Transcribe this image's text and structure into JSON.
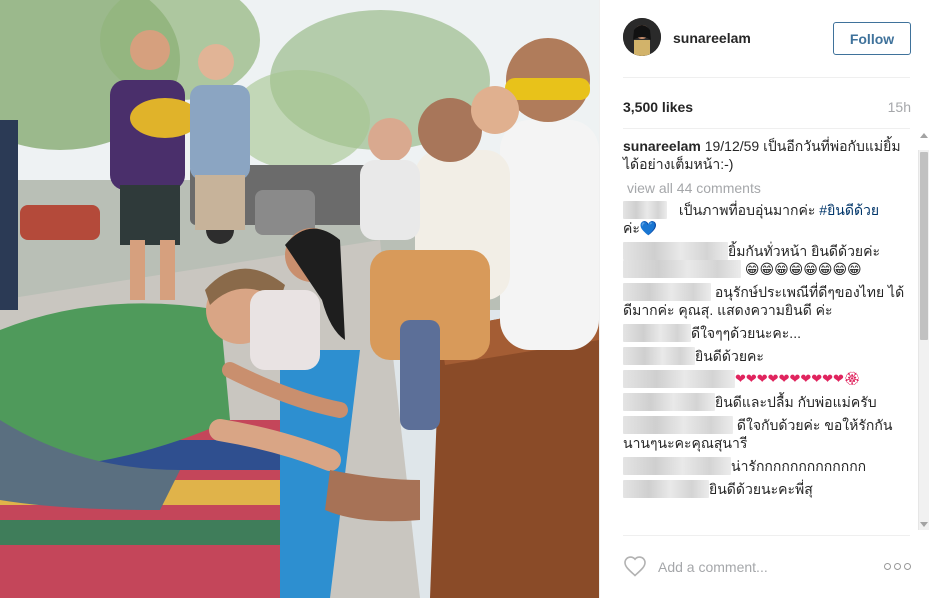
{
  "post": {
    "username": "sunareelam",
    "follow_label": "Follow",
    "likes": "3,500 likes",
    "time": "15h",
    "caption_user": "sunareelam",
    "caption_text": " 19/12/59 เป็นอีกวันที่พ่อกับแม่ยิ้มได้อย่างเต็มหน้า:-)",
    "view_all": "view all 44 comments",
    "add_comment_placeholder": "Add a comment..."
  },
  "comments": [
    {
      "text": "เป็นภาพที่อบอุ่นมากค่ะ ",
      "hashtag": "#ยินดีด้วย",
      "text2": "ค่ะ💙"
    },
    {
      "text": "ยิ้มกันทั่วหน้า ยินดีด้วยค่ะ",
      "emoji": "😁😁😁😁😁😁😁😁"
    },
    {
      "text": "อนุรักษ์ประเพณีที่ดีๆของไทย ได้ดีมากค่ะ คุณสุ. แสดงความยินดี ค่ะ"
    },
    {
      "text": "ดีใจๆๆด้วยนะคะ..."
    },
    {
      "text": "ยินดีด้วยคะ"
    },
    {
      "text": "❤❤❤❤❤❤❤❤❤❤🏵"
    },
    {
      "text": "ยินดีและปลื้ม กับพ่อแม่ครับ"
    },
    {
      "text": "ดีใจกับด้วยค่ะ ขอให้รักกันนานๆนะคะคุณสุนารี"
    },
    {
      "text": "น่ารักกกกกกกกกกกกก"
    },
    {
      "text": "ยินดีด้วยนะคะพี่สุ"
    }
  ],
  "colors": {
    "follow": "#3f729b",
    "hashtag": "#003569",
    "muted": "#a5a7aa",
    "text": "#262626"
  },
  "icons": [
    "heart-icon",
    "more-options-icon"
  ]
}
